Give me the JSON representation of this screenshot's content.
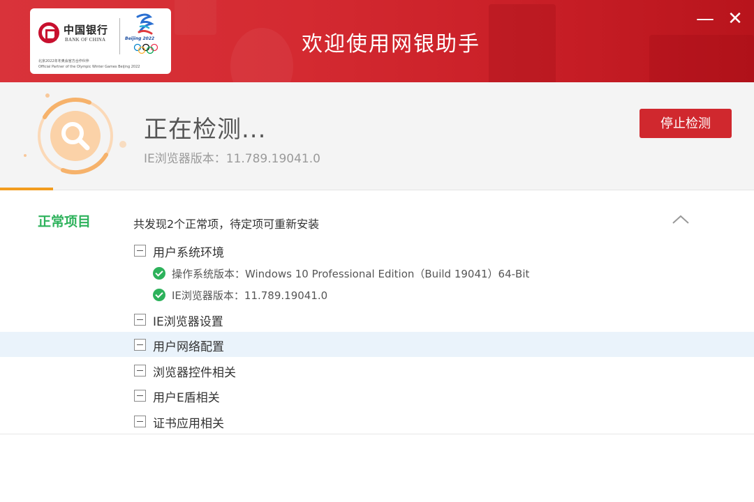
{
  "titlebar": {
    "app_title": "欢迎使用网银助手",
    "logo": {
      "bank_cn": "中国银行",
      "bank_en": "BANK OF CHINA",
      "games_mark": "Beijing 2022",
      "partner_cn": "北京2022年冬奥会官方合作伙伴",
      "partner_en": "Official Partner of the Olympic Winter Games Beijing 2022"
    },
    "minimize_symbol": "—",
    "close_symbol": "✕"
  },
  "status": {
    "title": "正在检测...",
    "subtitle": "IE浏览器版本：11.789.19041.0",
    "stop_button": "停止检测",
    "progress": 0.07,
    "icon": "search-icon"
  },
  "results": {
    "category": "正常项目",
    "summary": "共发现2个正常项，待定项可重新安装",
    "collapse_icon": "chevron-up-icon",
    "groups": [
      {
        "label": "用户系统环境",
        "items": [
          "操作系统版本：Windows 10 Professional Edition（Build 19041）64-Bit",
          "IE浏览器版本：11.789.19041.0"
        ]
      },
      {
        "label": "IE浏览器设置",
        "items": []
      },
      {
        "label": "用户网络配置",
        "items": []
      },
      {
        "label": "浏览器控件相关",
        "items": []
      },
      {
        "label": "用户E盾相关",
        "items": []
      },
      {
        "label": "证书应用相关",
        "items": []
      }
    ]
  },
  "colors": {
    "brand_red": "#d0282e",
    "ok_green": "#2db25b",
    "progress_orange": "#f29c1f",
    "row_highlight": "#eaf3fb"
  }
}
